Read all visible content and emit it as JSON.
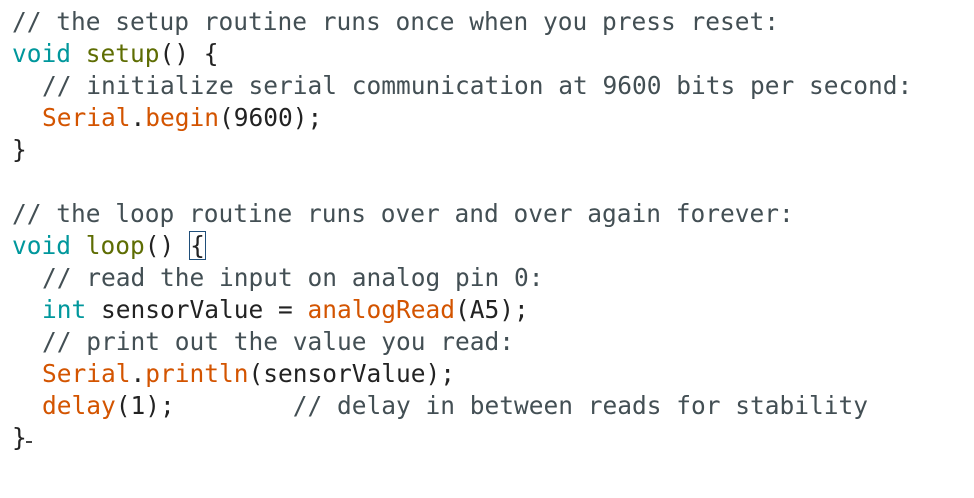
{
  "code": {
    "setup_comment": "// the setup routine runs once when you press reset:",
    "setup_kw": "void",
    "setup_fn": "setup",
    "setup_open": "() {",
    "serial_comment": "// initialize serial communication at 9600 bits per second:",
    "serial_obj": "Serial",
    "serial_dot": ".",
    "serial_begin": "begin",
    "serial_args": "(9600);",
    "setup_close": "}",
    "loop_comment": "// the loop routine runs over and over again forever:",
    "loop_kw": "void",
    "loop_fn": "loop",
    "loop_parens": "() ",
    "loop_brace": "{",
    "read_comment": "// read the input on analog pin 0:",
    "int_kw": "int",
    "sensor_decl": " sensorValue = ",
    "analog_fn": "analogRead",
    "analog_args": "(A5);",
    "print_comment": "// print out the value you read:",
    "print_obj": "Serial",
    "print_dot": ".",
    "print_fn": "println",
    "print_args": "(sensorValue);",
    "delay_fn": "delay",
    "delay_args": "(1);",
    "delay_gap": "        ",
    "delay_comment": "// delay in between reads for stability",
    "loop_close": "}"
  }
}
